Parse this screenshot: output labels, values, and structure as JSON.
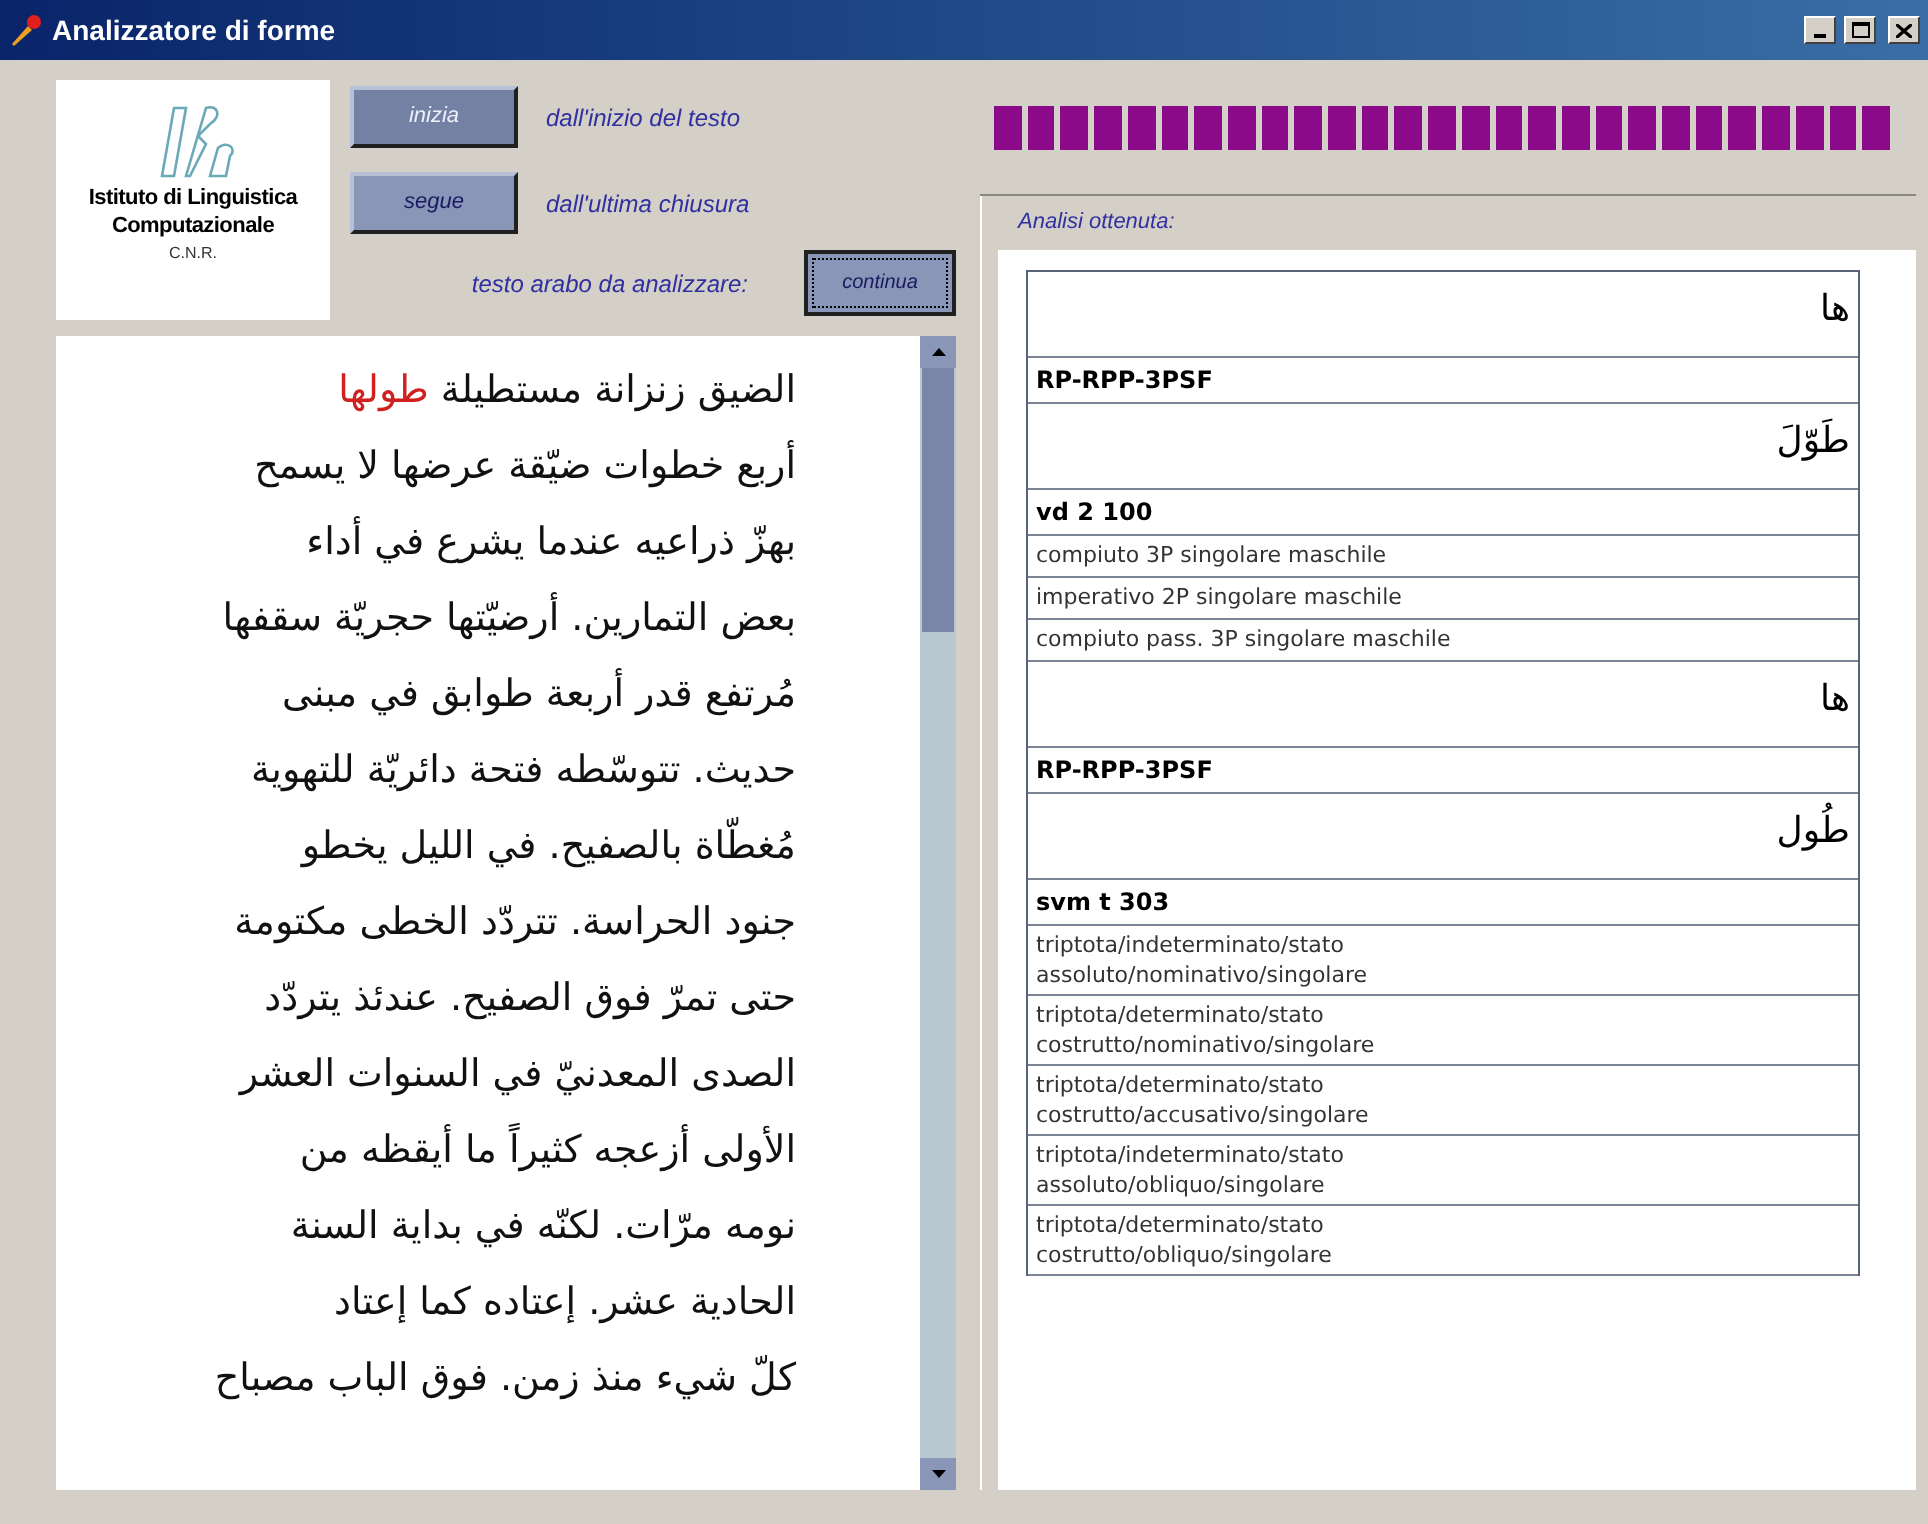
{
  "window": {
    "title": "Analizzatore di forme"
  },
  "logo": {
    "lines": [
      "Istituto di Linguistica",
      "Computazionale",
      "C.N.R."
    ]
  },
  "actions": [
    {
      "label": "inizia",
      "disabled": true,
      "description": "dall'inizio del testo"
    },
    {
      "label": "segue",
      "disabled": false,
      "description": "dall'ultima chiusura"
    }
  ],
  "input": {
    "label": "testo arabo da analizzare:",
    "button": "continua",
    "lines": [
      {
        "segments": [
          {
            "text": "الضيق زنزانة مستطيلة ",
            "highlighted": false
          },
          {
            "text": "طولها",
            "highlighted": true
          }
        ]
      },
      {
        "segments": [
          {
            "text": "أربع خطوات ضيّقة عرضها لا يسمح",
            "highlighted": false
          }
        ]
      },
      {
        "segments": [
          {
            "text": "بهزّ ذراعيه عندما يشرع في أداء",
            "highlighted": false
          }
        ]
      },
      {
        "segments": [
          {
            "text": "بعض التمارين. أرضيّتها حجريّة سقفها",
            "highlighted": false
          }
        ]
      },
      {
        "segments": [
          {
            "text": "مُرتفع قدر أربعة طوابق في مبنى",
            "highlighted": false
          }
        ]
      },
      {
        "segments": [
          {
            "text": "حديث. تتوسّطه فتحة دائريّة للتهوية",
            "highlighted": false
          }
        ]
      },
      {
        "segments": [
          {
            "text": "مُغطّاة بالصفيح. في الليل يخطو",
            "highlighted": false
          }
        ]
      },
      {
        "segments": [
          {
            "text": "جنود الحراسة. تتردّد الخطى مكتومة",
            "highlighted": false
          }
        ]
      },
      {
        "segments": [
          {
            "text": "حتى تمرّ فوق الصفيح. عندئذ يتردّد",
            "highlighted": false
          }
        ]
      },
      {
        "segments": [
          {
            "text": "الصدى المعدنيّ في السنوات العشر",
            "highlighted": false
          }
        ]
      },
      {
        "segments": [
          {
            "text": "الأولى أزعجه كثيراً ما أيقظه من",
            "highlighted": false
          }
        ]
      },
      {
        "segments": [
          {
            "text": "نومه مرّات. لكنّه في بداية السنة",
            "highlighted": false
          }
        ]
      },
      {
        "segments": [
          {
            "text": "الحادية عشر. إعتاده كما إعتاد",
            "highlighted": false
          }
        ]
      },
      {
        "segments": [
          {
            "text": "كلّ شيء منذ زمن. فوق الباب مصباح",
            "highlighted": false
          }
        ]
      }
    ]
  },
  "progress": {
    "level": 1
  },
  "results": {
    "label": "Analisi ottenuta:",
    "rows": [
      {
        "kind": "arabic",
        "text": "ها"
      },
      {
        "kind": "code",
        "text": "RP-RPP-3PSF"
      },
      {
        "kind": "arabic",
        "text": "طَوّلَ"
      },
      {
        "kind": "code",
        "text": "vd 2 100"
      },
      {
        "kind": "text",
        "text": "compiuto 3P singolare maschile"
      },
      {
        "kind": "text",
        "text": "imperativo 2P singolare maschile"
      },
      {
        "kind": "text",
        "text": "compiuto pass. 3P singolare maschile"
      },
      {
        "kind": "arabic",
        "text": "ها"
      },
      {
        "kind": "code",
        "text": "RP-RPP-3PSF"
      },
      {
        "kind": "arabic",
        "text": "طُول"
      },
      {
        "kind": "code",
        "text": "svm t 303"
      },
      {
        "kind": "text",
        "text": "triptota/indeterminato/stato assoluto/nominativo/singolare"
      },
      {
        "kind": "text",
        "text": "triptota/determinato/stato costrutto/nominativo/singolare"
      },
      {
        "kind": "text",
        "text": "triptota/determinato/stato costrutto/accusativo/singolare"
      },
      {
        "kind": "text",
        "text": "triptota/indeterminato/stato assoluto/obliquo/singolare"
      },
      {
        "kind": "text",
        "text": "triptota/determinato/stato costrutto/obliquo/singolare"
      }
    ]
  }
}
